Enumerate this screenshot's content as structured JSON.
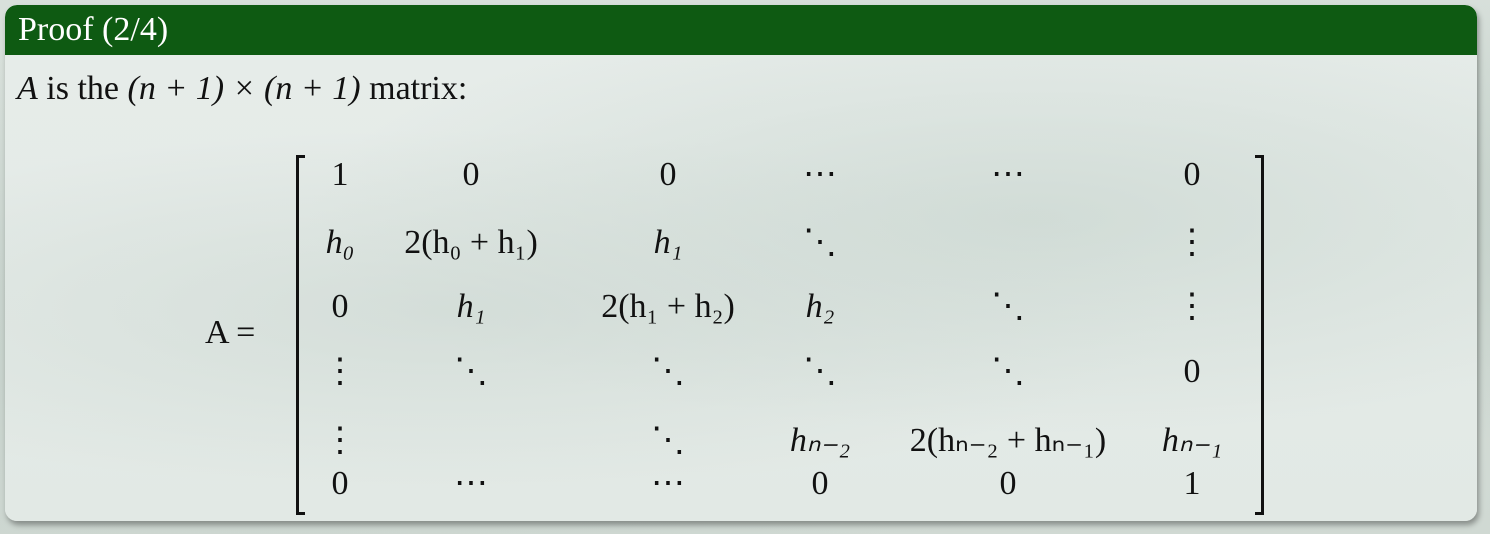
{
  "block": {
    "title": "Proof (2/4)",
    "header_color": "#0e5a12"
  },
  "statement": {
    "var": "A",
    "text1": " is the ",
    "dims": "(n + 1) × (n + 1)",
    "text2": " matrix:"
  },
  "equation": {
    "lhs": "A ="
  },
  "matrix": {
    "rows": [
      [
        "1",
        "0",
        "0",
        "⋯",
        "⋯",
        "0"
      ],
      [
        "h₀",
        "2(h₀ + h₁)",
        "h₁",
        "⋱",
        "",
        "⋮"
      ],
      [
        "0",
        "h₁",
        "2(h₁ + h₂)",
        "h₂",
        "⋱",
        "⋮"
      ],
      [
        "⋮",
        "⋱",
        "⋱",
        "⋱",
        "⋱",
        "0"
      ],
      [
        "⋮",
        "",
        "⋱",
        "hₙ₋₂",
        "2(hₙ₋₂ + hₙ₋₁)",
        "hₙ₋₁"
      ],
      [
        "0",
        "⋯",
        "⋯",
        "0",
        "0",
        "1"
      ]
    ]
  }
}
